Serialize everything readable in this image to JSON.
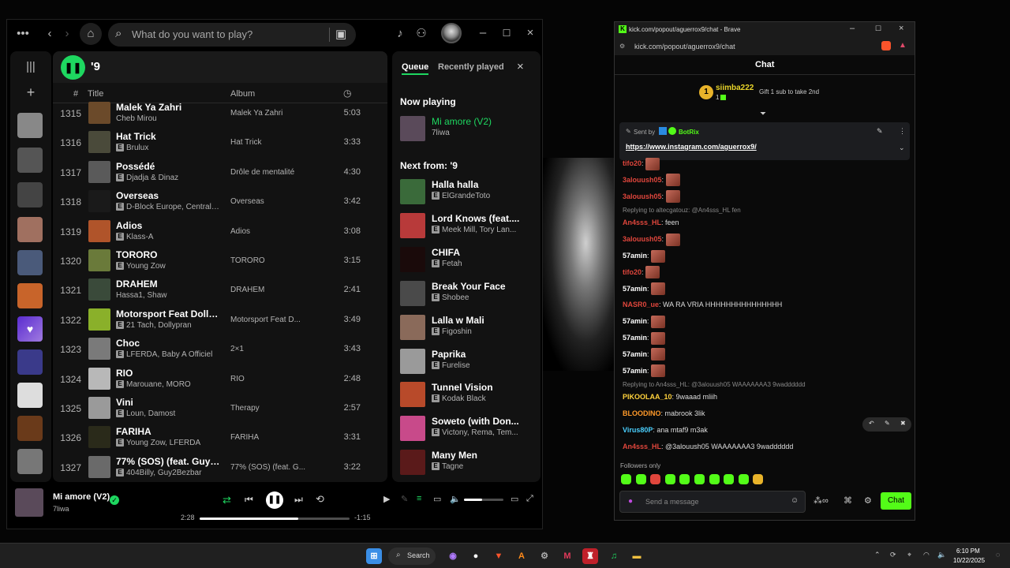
{
  "spotify": {
    "search_placeholder": "What do you want to play?",
    "playlist_name": "'9",
    "columns": {
      "num": "#",
      "title": "Title",
      "album": "Album"
    },
    "tracks": [
      {
        "num": "1315",
        "title": "Malek Ya Zahri",
        "artist": "Cheb Mirou",
        "explicit": false,
        "album": "Malek Ya Zahri",
        "duration": "5:03",
        "color": "#6b4a2a"
      },
      {
        "num": "1316",
        "title": "Hat Trick",
        "artist": "Brulux",
        "explicit": true,
        "album": "Hat Trick",
        "duration": "3:33",
        "color": "#4a4a3a"
      },
      {
        "num": "1317",
        "title": "Possédé",
        "artist": "Djadja & Dinaz",
        "explicit": true,
        "album": "Drôle de mentalité",
        "duration": "4:30",
        "color": "#5a5a5a"
      },
      {
        "num": "1318",
        "title": "Overseas",
        "artist": "D-Block Europe, Central C...",
        "explicit": true,
        "album": "Overseas",
        "duration": "3:42",
        "color": "#1a1a1a"
      },
      {
        "num": "1319",
        "title": "Adios",
        "artist": "Klass-A",
        "explicit": true,
        "album": "Adios",
        "duration": "3:08",
        "color": "#b0542a"
      },
      {
        "num": "1320",
        "title": "TORORO",
        "artist": "Young Zow",
        "explicit": true,
        "album": "TORORO",
        "duration": "3:15",
        "color": "#6a7a3a"
      },
      {
        "num": "1321",
        "title": "DRAHEM",
        "artist": "Hassa1, Shaw",
        "explicit": false,
        "album": "DRAHEM",
        "duration": "2:41",
        "color": "#3a4a3a"
      },
      {
        "num": "1322",
        "title": "Motorsport Feat Dollypran",
        "artist": "21 Tach, Dollypran",
        "explicit": true,
        "album": "Motorsport Feat D...",
        "duration": "3:49",
        "color": "#8ab02a"
      },
      {
        "num": "1323",
        "title": "Choc",
        "artist": "LFERDA, Baby A Officiel",
        "explicit": true,
        "album": "2×1",
        "duration": "3:43",
        "color": "#7a7a7a"
      },
      {
        "num": "1324",
        "title": "RIO",
        "artist": "Marouane, MORO",
        "explicit": true,
        "album": "RIO",
        "duration": "2:48",
        "color": "#b8b8b8"
      },
      {
        "num": "1325",
        "title": "Vini",
        "artist": "Loun, Damost",
        "explicit": true,
        "album": "Therapy",
        "duration": "2:57",
        "color": "#9a9a9a"
      },
      {
        "num": "1326",
        "title": "FARIHA",
        "artist": "Young Zow, LFERDA",
        "explicit": true,
        "album": "FARIHA",
        "duration": "3:31",
        "color": "#2a2a1a"
      },
      {
        "num": "1327",
        "title": "77% (SOS) (feat. Guy2Bez...",
        "artist": "404Billy, Guy2Bezbar",
        "explicit": true,
        "album": "77% (SOS) (feat. G...",
        "duration": "3:22",
        "color": "#6a6a6a"
      }
    ],
    "queue": {
      "tab_queue": "Queue",
      "tab_recent": "Recently played",
      "now_playing_label": "Now playing",
      "now_playing": {
        "title": "Mi amore (V2)",
        "artist": "7liwa",
        "color": "#5a4a5a"
      },
      "next_label": "Next from: '9",
      "items": [
        {
          "title": "Halla halla",
          "artist": "ElGrandeToto",
          "color": "#3a6a3a"
        },
        {
          "title": "Lord Knows (feat....",
          "artist": "Meek Mill, Tory Lan...",
          "color": "#b83a3a"
        },
        {
          "title": "CHIFA",
          "artist": "Fetah",
          "color": "#1a0a0a"
        },
        {
          "title": "Break Your Face",
          "artist": "Shobee",
          "color": "#4a4a4a"
        },
        {
          "title": "Lalla w Mali",
          "artist": "Figoshin",
          "color": "#8a6a5a"
        },
        {
          "title": "Paprika",
          "artist": "Furelise",
          "color": "#9a9a9a"
        },
        {
          "title": "Tunnel Vision",
          "artist": "Kodak Black",
          "color": "#b84a2a"
        },
        {
          "title": "Soweto (with Don...",
          "artist": "Victony, Rema, Tem...",
          "color": "#c84a8a"
        },
        {
          "title": "Many Men",
          "artist": "Tagne",
          "color": "#5a1a1a"
        }
      ]
    },
    "player": {
      "title": "Mi amore (V2)",
      "artist": "7liwa",
      "elapsed": "2:28",
      "remaining": "-1:15",
      "progress": 0.66,
      "volume": 0.45
    }
  },
  "brave": {
    "title": "kick.com/popout/aguerrox9/chat - Brave",
    "url": "kick.com/popout/aguerrox9/chat",
    "chat_header": "Chat",
    "top_gifter": {
      "rank": "1",
      "name": "siimba222",
      "count": "1",
      "gift_text": "Gift 1 sub to take 2nd"
    },
    "pinned": {
      "sent_by": "Sent by",
      "bot": "BotRix",
      "link": "https://www.instagram.com/aguerrox9/"
    },
    "messages": [
      {
        "user": "tifo20",
        "color": "#e0463c",
        "text": ":",
        "emotes": 1,
        "reply": ""
      },
      {
        "user": "3alouush05",
        "color": "#e0463c",
        "text": ":",
        "emotes": 1,
        "reply": ""
      },
      {
        "user": "3alouush05",
        "color": "#e0463c",
        "text": ":",
        "emotes": 1,
        "reply": ""
      },
      {
        "user": "An4sss_HL",
        "color": "#e0463c",
        "text": ": feen",
        "emotes": 0,
        "reply": "Replying to altecgatouz: @An4sss_HL fen"
      },
      {
        "user": "3alouush05",
        "color": "#e0463c",
        "text": ":",
        "emotes": 1,
        "reply": ""
      },
      {
        "user": "57amin",
        "color": "#ffffff",
        "text": ":",
        "emotes": 1,
        "reply": ""
      },
      {
        "user": "tifo20",
        "color": "#e0463c",
        "text": ":",
        "emotes": 1,
        "reply": ""
      },
      {
        "user": "57amin",
        "color": "#ffffff",
        "text": ":",
        "emotes": 1,
        "reply": ""
      },
      {
        "user": "NASR0_ue",
        "color": "#e0463c",
        "text": ": WA RA VRIA HHHHHHHHHHHHHHH",
        "emotes": 0,
        "reply": ""
      },
      {
        "user": "57amin",
        "color": "#ffffff",
        "text": ":",
        "emotes": 1,
        "reply": ""
      },
      {
        "user": "57amin",
        "color": "#ffffff",
        "text": ":",
        "emotes": 1,
        "reply": ""
      },
      {
        "user": "57amin",
        "color": "#ffffff",
        "text": ":",
        "emotes": 1,
        "reply": ""
      },
      {
        "user": "57amin",
        "color": "#ffffff",
        "text": ":",
        "emotes": 1,
        "reply": ""
      },
      {
        "user": "PIKOOLAA_10",
        "color": "#ffd23c",
        "text": ": 9waaad mliih",
        "emotes": 0,
        "reply": "Replying to An4sss_HL: @3alouush05 WAAAAAAA3 9wadddddd"
      },
      {
        "user": "BLOODINO",
        "color": "#ff9a2a",
        "text": ": mabrook 3lik",
        "emotes": 0,
        "reply": ""
      },
      {
        "user": "Virus80P",
        "color": "#4ad0ff",
        "text": ": ana mtaf9 m3ak",
        "emotes": 0,
        "reply": ""
      },
      {
        "user": "An4sss_HL",
        "color": "#e0463c",
        "text": ": @3alouush05 WAAAAAAA3 9wadddddd",
        "emotes": 0,
        "reply": ""
      }
    ],
    "followers_only": "Followers only",
    "input_placeholder": "Send a message",
    "chat_button": "Chat"
  },
  "taskbar": {
    "search": "Search",
    "time": "6:10 PM",
    "date": "10/22/2025"
  }
}
